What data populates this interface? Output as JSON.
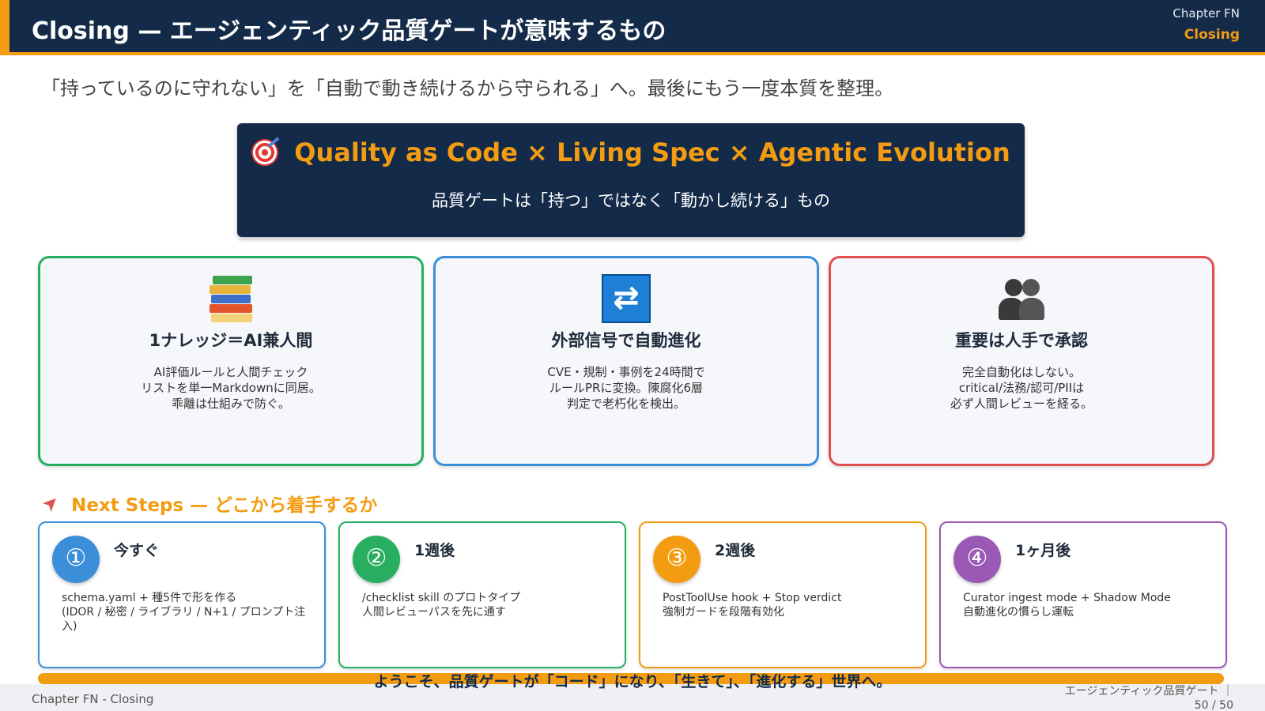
{
  "header": {
    "title": "Closing — エージェンティック品質ゲートが意味するもの",
    "chapter_label": "Chapter FN",
    "section_label": "Closing"
  },
  "subtitle": "「持っているのに守れない」を「自動で動き続けるから守られる」へ。最後にもう一度本質を整理。",
  "banner": {
    "icon": "target-icon",
    "title": "Quality as Code × Living Spec × Agentic Evolution",
    "subtitle": "品質ゲートは「持つ」ではなく「動かし続ける」もの"
  },
  "pillars": [
    {
      "icon": "books-icon",
      "title": "1ナレッジ＝AI兼人間",
      "lines": [
        "AI評価ルールと人間チェック",
        "リストを単一Markdownに同居。",
        "乖離は仕組みで防ぐ。"
      ],
      "color": "#27ae60"
    },
    {
      "icon": "repeat-icon",
      "title": "外部信号で自動進化",
      "lines": [
        "CVE・規制・事例を24時間で",
        "ルールPRに変換。陳腐化6層",
        "判定で老朽化を検出。"
      ],
      "color": "#3b8fd9"
    },
    {
      "icon": "people-icon",
      "title": "重要は人手で承認",
      "lines": [
        "完全自動化はしない。",
        "critical/法務/認可/PIIは",
        "必ず人間レビューを経る。"
      ],
      "color": "#e05050"
    }
  ],
  "next_steps": {
    "icon": "rocket-icon",
    "title": "Next Steps — どこから着手するか",
    "steps": [
      {
        "num": "①",
        "title": "今すぐ",
        "lines": [
          "schema.yaml + 種5件で形を作る",
          "(IDOR / 秘密 / ライブラリ / N+1 / プロンプト注",
          "入)"
        ],
        "color": "#3b8fd9"
      },
      {
        "num": "②",
        "title": "1週後",
        "lines": [
          "/checklist skill のプロトタイプ",
          "人間レビューパスを先に通す"
        ],
        "color": "#27ae60"
      },
      {
        "num": "③",
        "title": "2週後",
        "lines": [
          "PostToolUse hook + Stop verdict",
          "強制ガードを段階有効化"
        ],
        "color": "#f39c12"
      },
      {
        "num": "④",
        "title": "1ヶ月後",
        "lines": [
          "Curator ingest mode + Shadow Mode",
          "自動進化の慣らし運転"
        ],
        "color": "#9b59b6"
      }
    ]
  },
  "welcome": "ようこそ、品質ゲートが「コード」になり、「生きて」、「進化する」世界へ。",
  "footer": {
    "left": "Chapter FN - Closing",
    "right_title": "エージェンティック品質ゲート ｜",
    "page": "50 / 50"
  }
}
